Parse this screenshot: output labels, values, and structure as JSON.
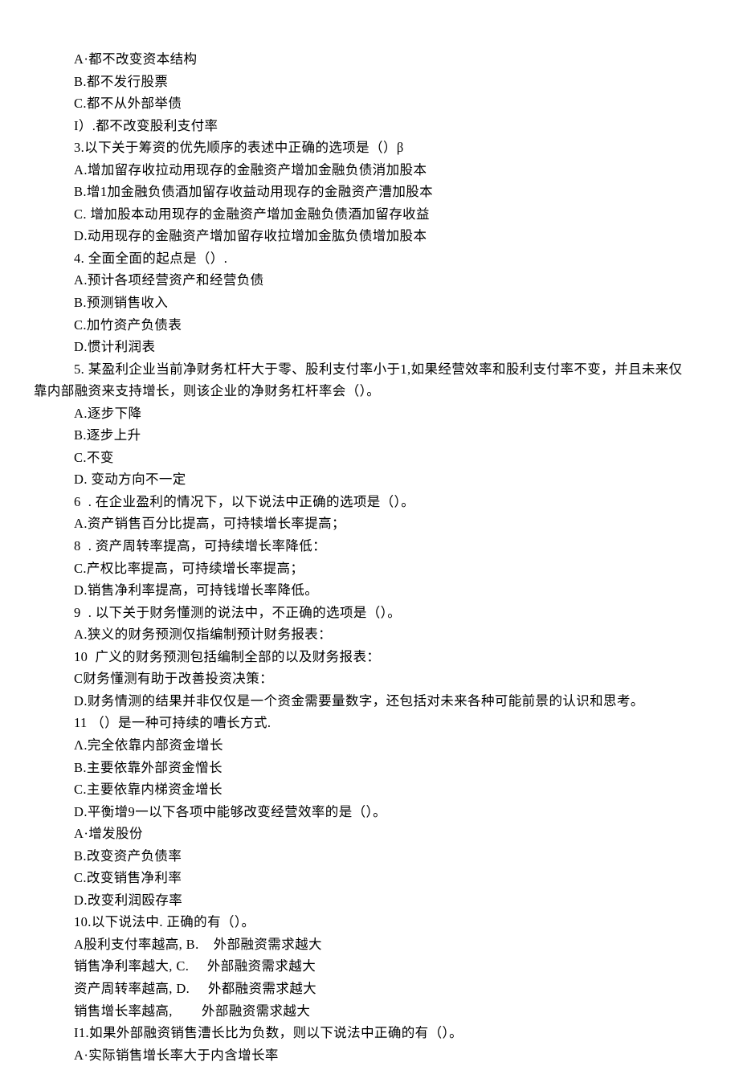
{
  "lines": [
    {
      "indent": true,
      "text": "A·都不改变资本结构"
    },
    {
      "indent": true,
      "text": "B.都不发行股票"
    },
    {
      "indent": true,
      "text": "C.都不从外部举债"
    },
    {
      "indent": true,
      "text": "I）.都不改变股利支付率"
    },
    {
      "indent": true,
      "text": "3.以下关于筹资的优先顺序的表述中正确的选项是（）β"
    },
    {
      "indent": true,
      "text": "A.增加留存收拉动用现存的金融资产增加金融负债消加股本"
    },
    {
      "indent": true,
      "text": "B.增1加金融负债酒加留存收益动用现存的金融资产漕加股本"
    },
    {
      "indent": true,
      "text": "C. 增加股本动用现存的金融资产增加金融负债酒加留存收益"
    },
    {
      "indent": true,
      "text": "D.动用现存的金融资产增加留存收拉增加金肱负债增加股本"
    },
    {
      "indent": true,
      "text": "4. 全面全面的起点是（）."
    },
    {
      "indent": true,
      "text": "A.预计各项经营资产和经营负债"
    },
    {
      "indent": true,
      "text": "B.预测销售收入"
    },
    {
      "indent": true,
      "text": "C.加竹资产负债表"
    },
    {
      "indent": true,
      "text": "D.惯计利润表"
    },
    {
      "indent": true,
      "text": "5. 某盈利企业当前净财务杠杆大于零、股利支付率小于1,如果经营效率和股利支付率不变，并且未来仅"
    },
    {
      "indent": false,
      "text": "靠内部融资来支持增长，则该企业的净财务杠杆率会（）。"
    },
    {
      "indent": true,
      "text": "A.逐步下降"
    },
    {
      "indent": true,
      "text": "B.逐步上升"
    },
    {
      "indent": true,
      "text": "C.不变"
    },
    {
      "indent": true,
      "text": "D. 变动方向不一定"
    },
    {
      "indent": true,
      "text": "6  . 在企业盈利的情况下，以下说法中正确的选项是（）。"
    },
    {
      "indent": true,
      "text": "A.资产销售百分比提高，可持犊增长率提高；"
    },
    {
      "indent": true,
      "text": "8  . 资产周转率提高，可持续增长率降低："
    },
    {
      "indent": true,
      "text": "C.产权比率提高，可持续增长率提高；"
    },
    {
      "indent": true,
      "text": "D.销售净利率提高，可持钱增长率降低。"
    },
    {
      "indent": true,
      "text": "9  . 以下关于财务懂测的说法中，不正确的选项是（）。"
    },
    {
      "indent": true,
      "text": "A.狭义的财务预测仅指编制预计财务报表："
    },
    {
      "indent": true,
      "text": "10  广义的财务预测包括编制全部的以及财务报表："
    },
    {
      "indent": true,
      "text": "C财务懂测有助于改善投资决策："
    },
    {
      "indent": true,
      "text": "D.财务情测的结果并非仅仅是一个资金需要量数字，还包括对未来各种可能前景的认识和思考。"
    },
    {
      "indent": true,
      "text": "11 （）是一种可持续的嘈长方式."
    },
    {
      "indent": true,
      "text": "Λ.完全依靠内部资金增长"
    },
    {
      "indent": true,
      "text": "B.主要依靠外部资金憎长"
    },
    {
      "indent": true,
      "text": "C.主要依靠内梯资金增长"
    },
    {
      "indent": true,
      "text": "D.平衡增9一以下各项中能够改变经营效率的是（）。"
    },
    {
      "indent": true,
      "text": "A·增发股份"
    },
    {
      "indent": true,
      "text": "B.改变资产负债率"
    },
    {
      "indent": true,
      "text": "C.改变销售净利率"
    },
    {
      "indent": true,
      "text": "D.改变利润殴存率"
    },
    {
      "indent": true,
      "text": "10.以下说法中. 正确的有（）。"
    },
    {
      "indent": true,
      "text": "A股利支付率越高, B.    外部融资需求越大"
    },
    {
      "indent": true,
      "text": "销售净利率越大, C.     外部融资需求越大"
    },
    {
      "indent": true,
      "text": "资产周转率越高, D.     外都融资需求越大"
    },
    {
      "indent": true,
      "text": "销售增长率越高,        外部融资需求越大"
    },
    {
      "indent": true,
      "text": "I1.如果外部融资销售漕长比为负数，则以下说法中正确的有（）。"
    },
    {
      "indent": true,
      "text": "A·实际销售增长率大于内含增长率"
    }
  ]
}
